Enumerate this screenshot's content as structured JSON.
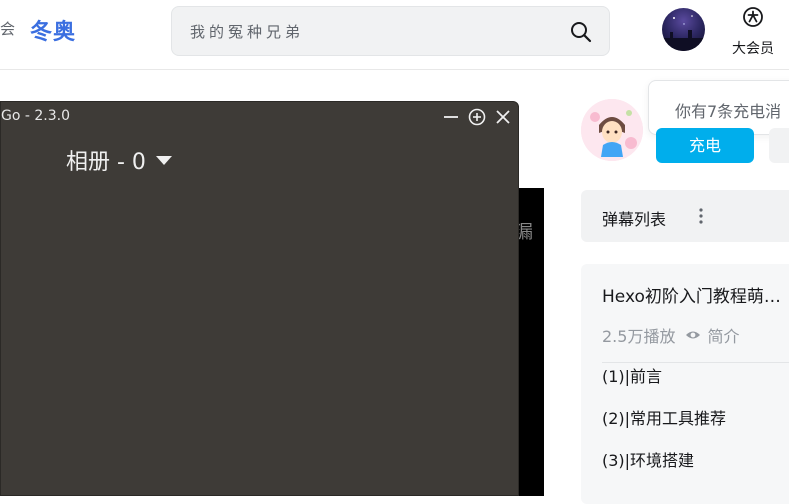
{
  "header": {
    "left_glyph": "会",
    "olympic_label": "冬奥",
    "search": {
      "placeholder": "我的冤种兄弟"
    },
    "vip_label": "大会员"
  },
  "app_window": {
    "title": "Go - 2.3.0",
    "album_label": "相册 - 0"
  },
  "player": {
    "edge_glyph": "漏"
  },
  "sidebar": {
    "charge_label": "充电",
    "toast_text": "你有7条充电消",
    "danmaku_label": "弹幕列表",
    "playlist": {
      "title": "Hexo初阶入门教程萌…",
      "plays": "2.5万播放",
      "intro": "简介",
      "items": [
        {
          "label": "(1)|前言"
        },
        {
          "label": "(2)|常用工具推荐"
        },
        {
          "label": "(3)|环境搭建"
        }
      ]
    }
  },
  "colors": {
    "accent": "#00aeec",
    "olympic": "#3b6fe0",
    "window_bg": "#3e3b37"
  }
}
